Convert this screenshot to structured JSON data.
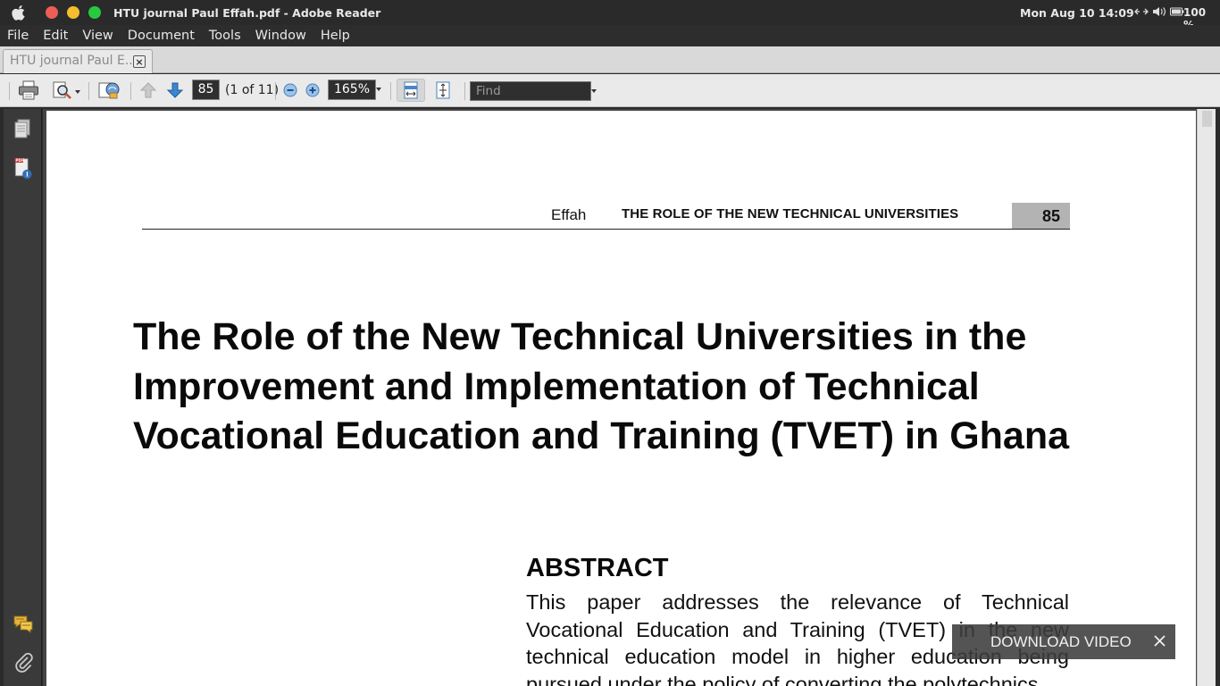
{
  "system_bar": {
    "window_title": "HTU journal Paul Effah.pdf - Adobe Reader",
    "clock": "Mon Aug 10  14:09",
    "battery_pct": "100 %",
    "status_icons": [
      "network-icon",
      "volume-icon",
      "battery-icon"
    ]
  },
  "menubar": {
    "items": [
      {
        "label": "File"
      },
      {
        "label": "Edit"
      },
      {
        "label": "View"
      },
      {
        "label": "Document"
      },
      {
        "label": "Tools"
      },
      {
        "label": "Window"
      },
      {
        "label": "Help"
      }
    ]
  },
  "tabs": [
    {
      "label": "HTU journal Paul E...",
      "close": "×"
    }
  ],
  "toolbar": {
    "page_number": "85",
    "page_of": "(1 of 11)",
    "zoom": "165%",
    "find_placeholder": "Find"
  },
  "document": {
    "running_author": "Effah",
    "running_title": "THE ROLE OF THE NEW TECHNICAL UNIVERSITIES",
    "page_number": "85",
    "title": "The Role of the New Technical Universities in the Improvement and Implementation of Technical Vocational Education and Training (TVET) in Ghana",
    "abstract_heading": "ABSTRACT",
    "abstract_text": "This paper addresses the relevance of Technical Vocational Education and Training (TVET) in the new technical education model in higher education being pursued under the policy of converting the polytechnics"
  },
  "overlay": {
    "label": "DOWNLOAD VIDEO"
  },
  "colors": {
    "close_red": "#ec5f56",
    "minimize_yellow": "#f4be2f",
    "maximize_green": "#28c840"
  }
}
